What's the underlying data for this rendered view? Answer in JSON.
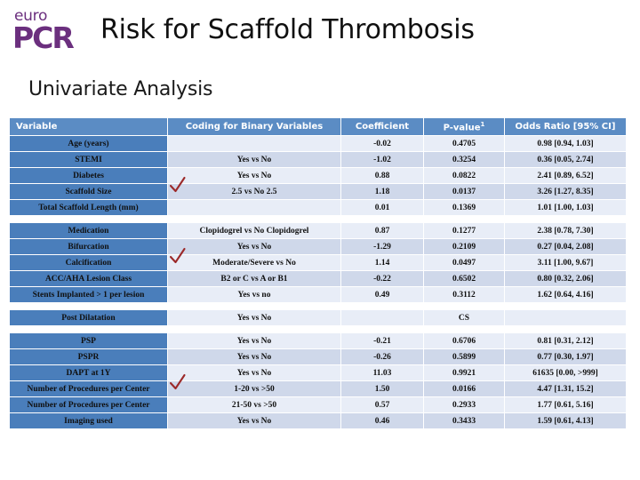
{
  "header": {
    "logo_top": "euro",
    "logo_bottom": "PCR",
    "logo_name": "europcr-logo",
    "title": "Risk for Scaffold Thrombosis",
    "subtitle": "Univariate Analysis"
  },
  "table": {
    "columns": [
      "Variable",
      "Coding for Binary Variables",
      "Coefficient",
      "P-value",
      "Odds Ratio [95% CI]"
    ],
    "pvalue_superscript": "1",
    "check_color": "#9c2a2a",
    "header_bg": "#5b8cc4",
    "variable_bg": "#4a7ebb",
    "band_a_bg": "#e8edf7",
    "band_b_bg": "#cfd8ea",
    "groups": [
      {
        "rows": [
          {
            "variable": "Age (years)",
            "coding": "",
            "coefficient": "-0.02",
            "pvalue": "0.4705",
            "odds_ratio": "0.98 [0.94, 1.03]",
            "checked": false
          },
          {
            "variable": "STEMI",
            "coding": "Yes vs No",
            "coefficient": "-1.02",
            "pvalue": "0.3254",
            "odds_ratio": "0.36 [0.05, 2.74]",
            "checked": false
          },
          {
            "variable": "Diabetes",
            "coding": "Yes vs No",
            "coefficient": "0.88",
            "pvalue": "0.0822",
            "odds_ratio": "2.41 [0.89, 6.52]",
            "checked": false
          },
          {
            "variable": "Scaffold Size",
            "coding": "2.5 vs No 2.5",
            "coefficient": "1.18",
            "pvalue": "0.0137",
            "odds_ratio": "3.26 [1.27, 8.35]",
            "checked": true
          },
          {
            "variable": "Total Scaffold Length (mm)",
            "coding": "",
            "coefficient": "0.01",
            "pvalue": "0.1369",
            "odds_ratio": "1.01 [1.00, 1.03]",
            "checked": false
          }
        ]
      },
      {
        "rows": [
          {
            "variable": "Medication",
            "coding": "Clopidogrel vs No Clopidogrel",
            "coefficient": "0.87",
            "pvalue": "0.1277",
            "odds_ratio": "2.38 [0.78, 7.30]",
            "checked": false
          },
          {
            "variable": "Bifurcation",
            "coding": "Yes vs No",
            "coefficient": "-1.29",
            "pvalue": "0.2109",
            "odds_ratio": "0.27 [0.04, 2.08]",
            "checked": false
          },
          {
            "variable": "Calcification",
            "coding": "Moderate/Severe vs No",
            "coefficient": "1.14",
            "pvalue": "0.0497",
            "odds_ratio": "3.11 [1.00, 9.67]",
            "checked": true
          },
          {
            "variable": "ACC/AHA Lesion Class",
            "coding": "B2 or C vs A or B1",
            "coefficient": "-0.22",
            "pvalue": "0.6502",
            "odds_ratio": "0.80 [0.32, 2.06]",
            "checked": false
          },
          {
            "variable": "Stents Implanted > 1 per lesion",
            "coding": "Yes vs no",
            "coefficient": "0.49",
            "pvalue": "0.3112",
            "odds_ratio": "1.62 [0.64, 4.16]",
            "checked": false
          }
        ]
      },
      {
        "rows": [
          {
            "variable": "Post Dilatation",
            "coding": "Yes vs No",
            "coefficient": "",
            "pvalue": "CS",
            "odds_ratio": "",
            "checked": false
          }
        ]
      },
      {
        "rows": [
          {
            "variable": "PSP",
            "coding": "Yes vs No",
            "coefficient": "-0.21",
            "pvalue": "0.6706",
            "odds_ratio": "0.81 [0.31, 2.12]",
            "checked": false
          },
          {
            "variable": "PSPR",
            "coding": "Yes vs No",
            "coefficient": "-0.26",
            "pvalue": "0.5899",
            "odds_ratio": "0.77 [0.30, 1.97]",
            "checked": false
          },
          {
            "variable": "DAPT at 1Y",
            "coding": "Yes vs No",
            "coefficient": "11.03",
            "pvalue": "0.9921",
            "odds_ratio": "61635 [0.00, >999]",
            "checked": false
          },
          {
            "variable": "Number of Procedures per Center",
            "coding": "1-20 vs >50",
            "coefficient": "1.50",
            "pvalue": "0.0166",
            "odds_ratio": "4.47 [1.31, 15.2]",
            "checked": true
          },
          {
            "variable": "Number of Procedures per Center",
            "coding": "21-50 vs >50",
            "coefficient": "0.57",
            "pvalue": "0.2933",
            "odds_ratio": "1.77 [0.61, 5.16]",
            "checked": false
          },
          {
            "variable": "Imaging used",
            "coding": "Yes vs No",
            "coefficient": "0.46",
            "pvalue": "0.3433",
            "odds_ratio": "1.59 [0.61, 4.13]",
            "checked": false
          }
        ]
      }
    ]
  }
}
